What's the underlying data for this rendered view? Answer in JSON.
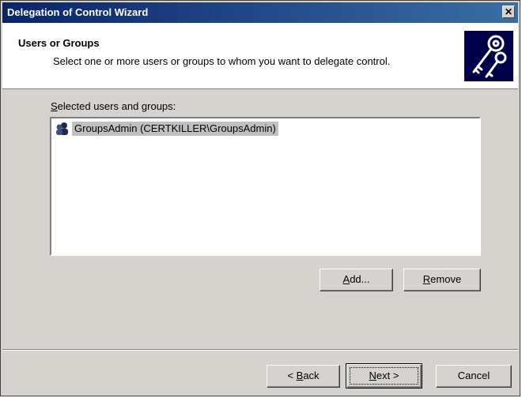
{
  "window": {
    "title": "Delegation of Control Wizard",
    "close_glyph": "✕"
  },
  "header": {
    "title": "Users or Groups",
    "subtitle": "Select one or more users or groups to whom you want to delegate control.",
    "icon": "keys-icon"
  },
  "list": {
    "label_prefix": "S",
    "label_rest": "elected users and groups:",
    "items": [
      {
        "icon": "group-icon",
        "text": "GroupsAdmin (CERTKILLER\\GroupsAdmin)"
      }
    ]
  },
  "buttons": {
    "add": {
      "mnemonic": "A",
      "rest": "dd..."
    },
    "remove": {
      "mnemonic": "R",
      "rest": "emove"
    },
    "back": {
      "prefix": "< ",
      "mnemonic": "B",
      "rest": "ack"
    },
    "next": {
      "mnemonic": "N",
      "rest": "ext >"
    },
    "cancel": "Cancel"
  },
  "colors": {
    "titlebar_start": "#0a246a",
    "titlebar_end": "#3a6ea5",
    "dialog_bg": "#d6d3ce"
  }
}
